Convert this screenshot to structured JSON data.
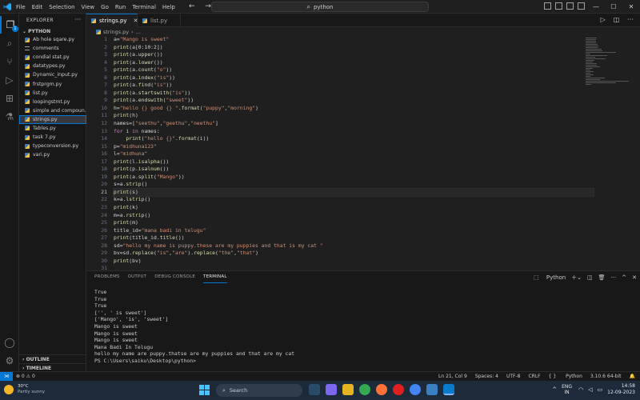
{
  "window": {
    "menu": [
      "File",
      "Edit",
      "Selection",
      "View",
      "Go",
      "Run",
      "Terminal",
      "Help"
    ],
    "search_text": "python"
  },
  "activity_bar": {
    "explorer_badge": "1"
  },
  "sidebar": {
    "title": "EXPLORER",
    "folder": "PYTHON",
    "files": [
      {
        "name": "Ab hole sqare.py",
        "type": "py"
      },
      {
        "name": "comments",
        "type": "txt"
      },
      {
        "name": "condial stat.py",
        "type": "py"
      },
      {
        "name": "datatypes.py",
        "type": "py"
      },
      {
        "name": "Dynamic_input.py",
        "type": "py"
      },
      {
        "name": "frstprgm.py",
        "type": "py"
      },
      {
        "name": "list.py",
        "type": "py"
      },
      {
        "name": "loopingstmt.py",
        "type": "py"
      },
      {
        "name": "simple and compoun...",
        "type": "py"
      },
      {
        "name": "strings.py",
        "type": "py",
        "active": true
      },
      {
        "name": "Tables.py",
        "type": "py"
      },
      {
        "name": "task 7.py",
        "type": "py"
      },
      {
        "name": "typeconversion.py",
        "type": "py"
      },
      {
        "name": "vari.py",
        "type": "py"
      }
    ],
    "sections": [
      "OUTLINE",
      "TIMELINE"
    ]
  },
  "tabs": [
    {
      "label": "strings.py",
      "active": true
    },
    {
      "label": "list.py",
      "active": false
    }
  ],
  "breadcrumb": {
    "file": "strings.py",
    "extra": "..."
  },
  "editor": {
    "current_line": 21,
    "lines": [
      "a=\"Mango is sweet\"",
      "print(a[0:10:2])",
      "print(a.upper())",
      "print(a.lower())",
      "print(a.count(\"o\"))",
      "print(a.index(\"is\"))",
      "print(a.find(\"is\"))",
      "print(a.startswith(\"is\"))",
      "print(a.endswith(\"sweet\"))",
      "h=\"hello {} good {} \".format(\"puppy\",\"morning\")",
      "print(h)",
      "names=[\"seethu\",\"geethu\",\"neethu\"]",
      "for i in names:",
      "    print(\"hello {}\".format(i))",
      "p=\"midhuna123\"",
      "l=\"midhuna\"",
      "print(l.isalpha())",
      "print(p.isalnum())",
      "print(a.split(\"Mango\"))",
      "s=a.strip()",
      "print(s)",
      "k=a.lstrip()",
      "print(k)",
      "m=a.rstrip()",
      "print(m)",
      "title_id=\"mana badi in telugu\"",
      "print(title_id.title())",
      "sd=\"hello my name is puppy.these are my puppies and that is my cat \"",
      "bv=sd.replace(\"is\",\"are\").replace(\"the\",\"that\")",
      "print(bv)"
    ]
  },
  "panel": {
    "tabs": [
      "PROBLEMS",
      "OUTPUT",
      "DEBUG CONSOLE",
      "TERMINAL"
    ],
    "active_tab": "TERMINAL",
    "terminal_label": "Python",
    "terminal_lines": [
      "True",
      "True",
      "True",
      "['', ' is sweet']",
      "['Mango', 'is', 'sweet']",
      "Mango is sweet",
      "Mango is sweet",
      "Mango is sweet",
      "Mana Badi In Telugu",
      "hello my name are puppy.thatse are my puppies and that are my cat",
      "PS C:\\Users\\saiku\\Desktop\\python>"
    ]
  },
  "status_bar": {
    "problems": "⊗ 0 ⚠ 0",
    "position": "Ln 21, Col 9",
    "spaces": "Spaces: 4",
    "encoding": "UTF-8",
    "eol": "CRLF",
    "language": "Python",
    "interpreter": "3.10.6 64-bit"
  },
  "taskbar": {
    "temperature": "30°C",
    "weather": "Partly sunny",
    "search_placeholder": "Search",
    "lang_top": "ENG",
    "lang_bottom": "IN",
    "time": "14:58",
    "date": "12-09-2023"
  },
  "colors": {
    "accent": "#0078d4",
    "editor_bg": "#1f1f1f",
    "taskbar_bg": "#1c2a3a"
  }
}
